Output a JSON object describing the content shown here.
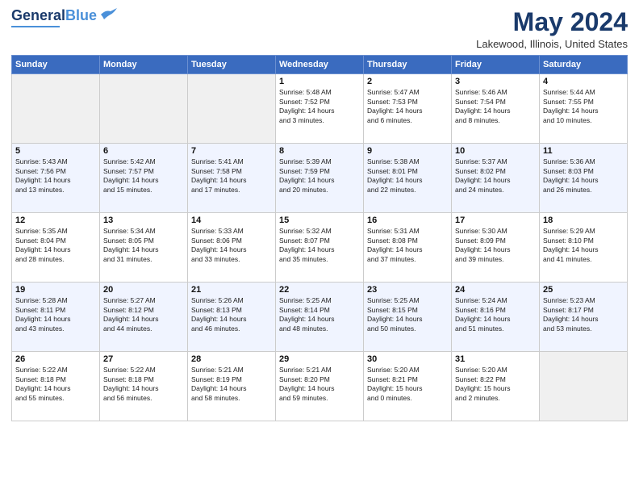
{
  "header": {
    "logo_line1": "General",
    "logo_line2": "Blue",
    "month": "May 2024",
    "location": "Lakewood, Illinois, United States"
  },
  "weekdays": [
    "Sunday",
    "Monday",
    "Tuesday",
    "Wednesday",
    "Thursday",
    "Friday",
    "Saturday"
  ],
  "weeks": [
    [
      {
        "day": "",
        "empty": true
      },
      {
        "day": "",
        "empty": true
      },
      {
        "day": "",
        "empty": true
      },
      {
        "day": "1",
        "info": "Sunrise: 5:48 AM\nSunset: 7:52 PM\nDaylight: 14 hours\nand 3 minutes."
      },
      {
        "day": "2",
        "info": "Sunrise: 5:47 AM\nSunset: 7:53 PM\nDaylight: 14 hours\nand 6 minutes."
      },
      {
        "day": "3",
        "info": "Sunrise: 5:46 AM\nSunset: 7:54 PM\nDaylight: 14 hours\nand 8 minutes."
      },
      {
        "day": "4",
        "info": "Sunrise: 5:44 AM\nSunset: 7:55 PM\nDaylight: 14 hours\nand 10 minutes."
      }
    ],
    [
      {
        "day": "5",
        "info": "Sunrise: 5:43 AM\nSunset: 7:56 PM\nDaylight: 14 hours\nand 13 minutes."
      },
      {
        "day": "6",
        "info": "Sunrise: 5:42 AM\nSunset: 7:57 PM\nDaylight: 14 hours\nand 15 minutes."
      },
      {
        "day": "7",
        "info": "Sunrise: 5:41 AM\nSunset: 7:58 PM\nDaylight: 14 hours\nand 17 minutes."
      },
      {
        "day": "8",
        "info": "Sunrise: 5:39 AM\nSunset: 7:59 PM\nDaylight: 14 hours\nand 20 minutes."
      },
      {
        "day": "9",
        "info": "Sunrise: 5:38 AM\nSunset: 8:01 PM\nDaylight: 14 hours\nand 22 minutes."
      },
      {
        "day": "10",
        "info": "Sunrise: 5:37 AM\nSunset: 8:02 PM\nDaylight: 14 hours\nand 24 minutes."
      },
      {
        "day": "11",
        "info": "Sunrise: 5:36 AM\nSunset: 8:03 PM\nDaylight: 14 hours\nand 26 minutes."
      }
    ],
    [
      {
        "day": "12",
        "info": "Sunrise: 5:35 AM\nSunset: 8:04 PM\nDaylight: 14 hours\nand 28 minutes."
      },
      {
        "day": "13",
        "info": "Sunrise: 5:34 AM\nSunset: 8:05 PM\nDaylight: 14 hours\nand 31 minutes."
      },
      {
        "day": "14",
        "info": "Sunrise: 5:33 AM\nSunset: 8:06 PM\nDaylight: 14 hours\nand 33 minutes."
      },
      {
        "day": "15",
        "info": "Sunrise: 5:32 AM\nSunset: 8:07 PM\nDaylight: 14 hours\nand 35 minutes."
      },
      {
        "day": "16",
        "info": "Sunrise: 5:31 AM\nSunset: 8:08 PM\nDaylight: 14 hours\nand 37 minutes."
      },
      {
        "day": "17",
        "info": "Sunrise: 5:30 AM\nSunset: 8:09 PM\nDaylight: 14 hours\nand 39 minutes."
      },
      {
        "day": "18",
        "info": "Sunrise: 5:29 AM\nSunset: 8:10 PM\nDaylight: 14 hours\nand 41 minutes."
      }
    ],
    [
      {
        "day": "19",
        "info": "Sunrise: 5:28 AM\nSunset: 8:11 PM\nDaylight: 14 hours\nand 43 minutes."
      },
      {
        "day": "20",
        "info": "Sunrise: 5:27 AM\nSunset: 8:12 PM\nDaylight: 14 hours\nand 44 minutes."
      },
      {
        "day": "21",
        "info": "Sunrise: 5:26 AM\nSunset: 8:13 PM\nDaylight: 14 hours\nand 46 minutes."
      },
      {
        "day": "22",
        "info": "Sunrise: 5:25 AM\nSunset: 8:14 PM\nDaylight: 14 hours\nand 48 minutes."
      },
      {
        "day": "23",
        "info": "Sunrise: 5:25 AM\nSunset: 8:15 PM\nDaylight: 14 hours\nand 50 minutes."
      },
      {
        "day": "24",
        "info": "Sunrise: 5:24 AM\nSunset: 8:16 PM\nDaylight: 14 hours\nand 51 minutes."
      },
      {
        "day": "25",
        "info": "Sunrise: 5:23 AM\nSunset: 8:17 PM\nDaylight: 14 hours\nand 53 minutes."
      }
    ],
    [
      {
        "day": "26",
        "info": "Sunrise: 5:22 AM\nSunset: 8:18 PM\nDaylight: 14 hours\nand 55 minutes."
      },
      {
        "day": "27",
        "info": "Sunrise: 5:22 AM\nSunset: 8:18 PM\nDaylight: 14 hours\nand 56 minutes."
      },
      {
        "day": "28",
        "info": "Sunrise: 5:21 AM\nSunset: 8:19 PM\nDaylight: 14 hours\nand 58 minutes."
      },
      {
        "day": "29",
        "info": "Sunrise: 5:21 AM\nSunset: 8:20 PM\nDaylight: 14 hours\nand 59 minutes."
      },
      {
        "day": "30",
        "info": "Sunrise: 5:20 AM\nSunset: 8:21 PM\nDaylight: 15 hours\nand 0 minutes."
      },
      {
        "day": "31",
        "info": "Sunrise: 5:20 AM\nSunset: 8:22 PM\nDaylight: 15 hours\nand 2 minutes."
      },
      {
        "day": "",
        "empty": true
      }
    ]
  ]
}
